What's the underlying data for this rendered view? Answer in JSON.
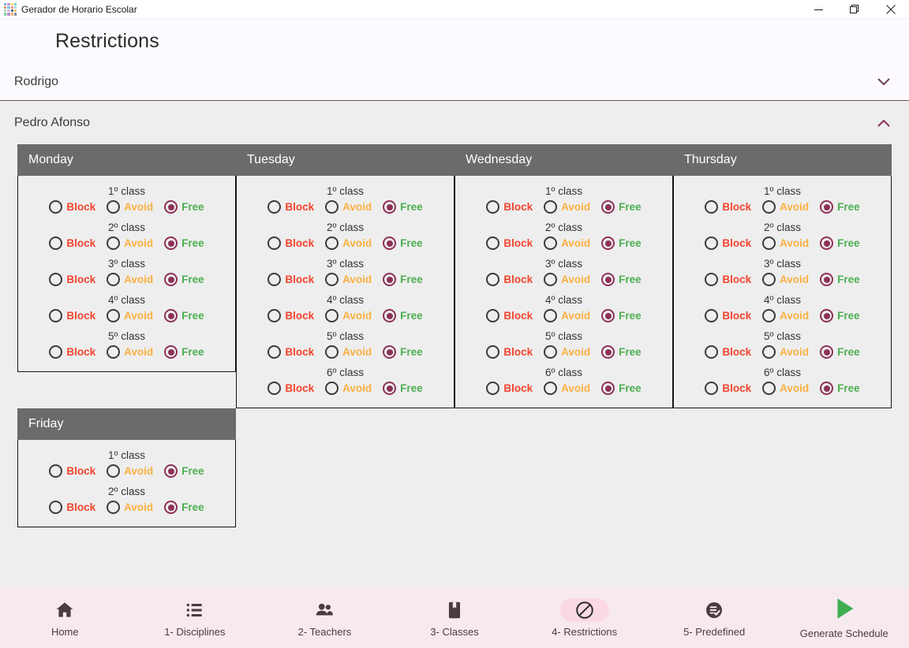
{
  "window": {
    "title": "Gerador de Horario Escolar",
    "app_icon": "schedule-grid-icon",
    "controls": {
      "minimize": "minimize-icon",
      "maximize": "restore-icon",
      "close": "close-icon"
    }
  },
  "page": {
    "title": "Restrictions"
  },
  "accordions": [
    {
      "label": "Rodrigo",
      "expanded": false,
      "chevron": "chevron-down-icon"
    },
    {
      "label": "Pedro Afonso",
      "expanded": true,
      "chevron": "chevron-up-icon"
    }
  ],
  "options": {
    "block": {
      "label": "Block",
      "color": "#f4442e"
    },
    "avoid": {
      "label": "Avoid",
      "color": "#fbb040"
    },
    "free": {
      "label": "Free",
      "color": "#4caf50"
    }
  },
  "selected_radio_color": "#8d3158",
  "day_header_color": "#6b6b6b",
  "days": [
    {
      "name": "Monday",
      "slots": [
        {
          "label": "1º class",
          "selected": "free"
        },
        {
          "label": "2º class",
          "selected": "free"
        },
        {
          "label": "3º class",
          "selected": "free"
        },
        {
          "label": "4º class",
          "selected": "free"
        },
        {
          "label": "5º class",
          "selected": "free"
        }
      ]
    },
    {
      "name": "Tuesday",
      "slots": [
        {
          "label": "1º class",
          "selected": "free"
        },
        {
          "label": "2º class",
          "selected": "free"
        },
        {
          "label": "3º class",
          "selected": "free"
        },
        {
          "label": "4º class",
          "selected": "free"
        },
        {
          "label": "5º class",
          "selected": "free"
        },
        {
          "label": "6º class",
          "selected": "free"
        }
      ]
    },
    {
      "name": "Wednesday",
      "slots": [
        {
          "label": "1º class",
          "selected": "free"
        },
        {
          "label": "2º class",
          "selected": "free"
        },
        {
          "label": "3º class",
          "selected": "free"
        },
        {
          "label": "4º class",
          "selected": "free"
        },
        {
          "label": "5º class",
          "selected": "free"
        },
        {
          "label": "6º class",
          "selected": "free"
        }
      ]
    },
    {
      "name": "Thursday",
      "slots": [
        {
          "label": "1º class",
          "selected": "free"
        },
        {
          "label": "2º class",
          "selected": "free"
        },
        {
          "label": "3º class",
          "selected": "free"
        },
        {
          "label": "4º class",
          "selected": "free"
        },
        {
          "label": "5º class",
          "selected": "free"
        },
        {
          "label": "6º class",
          "selected": "free"
        }
      ]
    },
    {
      "name": "Friday",
      "slots": [
        {
          "label": "1º class",
          "selected": "free"
        },
        {
          "label": "2º class",
          "selected": "free"
        }
      ]
    }
  ],
  "bottom_nav": {
    "items": [
      {
        "label": "Home",
        "icon": "home-icon",
        "active": false
      },
      {
        "label": "1- Disciplines",
        "icon": "list-icon",
        "active": false
      },
      {
        "label": "2- Teachers",
        "icon": "people-icon",
        "active": false
      },
      {
        "label": "3- Classes",
        "icon": "book-icon",
        "active": false
      },
      {
        "label": "4- Restrictions",
        "icon": "no-entry-icon",
        "active": true
      },
      {
        "label": "5- Predefined",
        "icon": "list-check-icon",
        "active": false
      },
      {
        "label": "Generate Schedule",
        "icon": "play-icon",
        "active": false
      }
    ]
  }
}
